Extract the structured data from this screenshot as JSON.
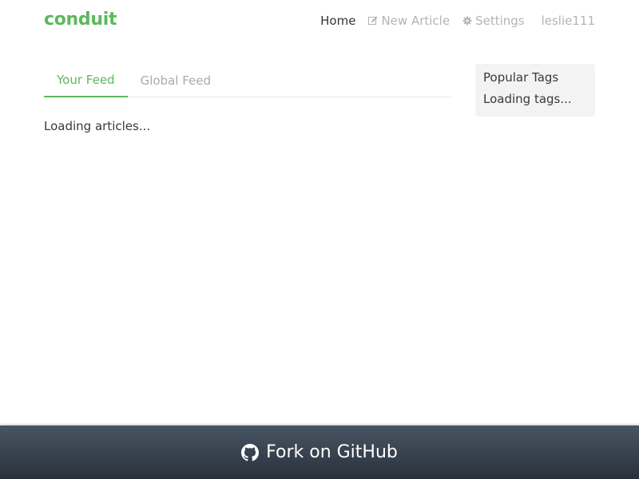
{
  "navbar": {
    "brand": "conduit",
    "links": {
      "home": "Home",
      "new_article": "New Article",
      "settings": "Settings",
      "profile": "leslie111"
    },
    "icons": {
      "new_article": "edit-icon",
      "settings": "gear-icon"
    }
  },
  "feed": {
    "tabs": [
      "Your Feed",
      "Global Feed"
    ],
    "active_tab": "Your Feed",
    "loading": "Loading articles..."
  },
  "sidebar": {
    "title": "Popular Tags",
    "loading": "Loading tags..."
  },
  "footer": {
    "label": "Fork on GitHub",
    "icon": "github-icon"
  },
  "colors": {
    "brand": "#5cb85c",
    "muted": "#aaaaaa",
    "text": "#373a3c",
    "sidebar_bg": "#f3f3f3",
    "footer_top": "#485563",
    "footer_bottom": "#29323c"
  }
}
